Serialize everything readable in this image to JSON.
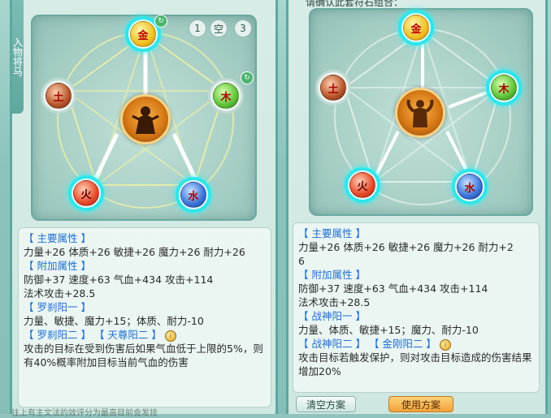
{
  "left": {
    "sidetab_label": "入物将马",
    "top_chips": [
      "1",
      "空",
      "3"
    ],
    "gems": {
      "top": "金",
      "right": "木",
      "bottom_right": "水",
      "bottom_left": "火",
      "left": "土"
    },
    "info": {
      "main_title": "【 主要属性 】",
      "main_line": "力量+26  体质+26  敏捷+26  魔力+26  耐力+26",
      "extra_title": "【 附加属性 】",
      "extra_line1": "防御+37  速度+63  气血+434  攻击+114",
      "extra_line2": "法术攻击+28.5",
      "set1_title": "【 罗刹阳一 】",
      "set1_line": "力量、敏捷、魔力+15；体质、耐力-10",
      "set2_title_a": "【 罗刹阳二 】",
      "set2_title_b": "【 天尊阳二 】",
      "coin": "i",
      "set2_text": "攻击的目标在受到伤害后如果气血低于上限的5%，则有40%概率附加目标当前气血的伤害"
    },
    "bottom_text": "往上有主文法的效评分为最高目前会发技"
  },
  "right": {
    "top_text": "请确认此套符石组合：",
    "gems": {
      "top": "金",
      "right": "木",
      "bottom_right": "水",
      "bottom_left": "火",
      "left": "土"
    },
    "info": {
      "main_title": "【 主要属性 】",
      "main_line1": "力量+26  体质+26  敏捷+26  魔力+26  耐力+2",
      "main_line2": "6",
      "extra_title": "【 附加属性 】",
      "extra_line1": "防御+37  速度+63  气血+434  攻击+114",
      "extra_line2": "法术攻击+28.5",
      "set1_title": "【 战神阳一 】",
      "set1_line": "力量、体质、敏捷+15；魔力、耐力-10",
      "set2_title_a": "【 战神阳二 】",
      "set2_title_b": "【 金刚阳二 】",
      "coin": "i",
      "set2_text": "攻击目标若触发保护，则对攻击目标造成的伤害结果增加20%"
    },
    "buttons": {
      "clear": "清空方案",
      "use": "使用方案"
    }
  }
}
